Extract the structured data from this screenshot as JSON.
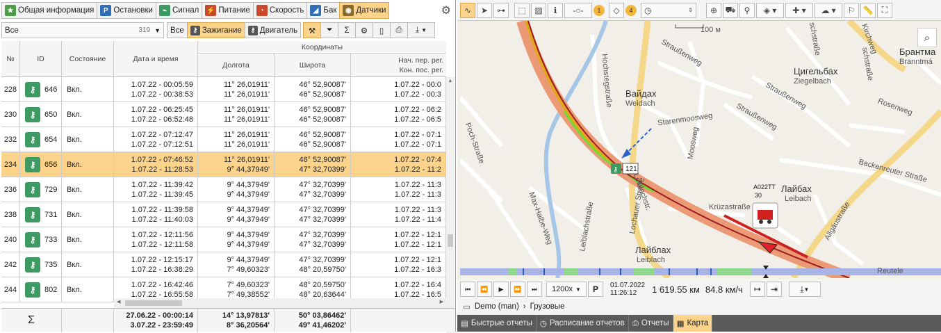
{
  "tabs": [
    {
      "label": "Общая информация",
      "icon": "star-icon",
      "color": "#4a9e4a"
    },
    {
      "label": "Остановки",
      "icon": "parking-icon",
      "color": "#2f6eb5"
    },
    {
      "label": "Сигнал",
      "icon": "signal-icon",
      "color": "#3e9a63"
    },
    {
      "label": "Питание",
      "icon": "power-icon",
      "color": "#c9492b"
    },
    {
      "label": "Скорость",
      "icon": "speed-icon",
      "color": "#c9492b"
    },
    {
      "label": "Бак",
      "icon": "fuel-icon",
      "color": "#2f6eb5"
    },
    {
      "label": "Датчики",
      "icon": "sensor-icon",
      "color": "#8a6a2a"
    }
  ],
  "toolbar": {
    "filter_value": "Все",
    "filter_count": "319",
    "all_button": "Все",
    "ignition_button": "Зажигание",
    "engine_button": "Двигатель"
  },
  "table": {
    "headers": {
      "num": "№",
      "id": "ID",
      "state": "Состояние",
      "datetime": "Дата и время",
      "coords": "Координаты",
      "lon": "Долгота",
      "lat": "Широта",
      "region_1": "Нач. пер. рег.",
      "region_2": "Кон. пос. рег."
    },
    "rows": [
      {
        "n": "228",
        "id": "646",
        "state": "Вкл.",
        "d1": "1.07.22 - 00:05:59",
        "d2": "1.07.22 - 00:38:53",
        "lon1": "11° 26,01911'",
        "lon2": "11° 26,01911'",
        "lat1": "46° 52,90087'",
        "lat2": "46° 52,90087'",
        "r1": "1.07.22 - 00:0",
        "r2": "1.07.22 - 00:3"
      },
      {
        "n": "230",
        "id": "650",
        "state": "Вкл.",
        "d1": "1.07.22 - 06:25:45",
        "d2": "1.07.22 - 06:52:48",
        "lon1": "11° 26,01911'",
        "lon2": "11° 26,01911'",
        "lat1": "46° 52,90087'",
        "lat2": "46° 52,90087'",
        "r1": "1.07.22 - 06:2",
        "r2": "1.07.22 - 06:5"
      },
      {
        "n": "232",
        "id": "654",
        "state": "Вкл.",
        "d1": "1.07.22 - 07:12:47",
        "d2": "1.07.22 - 07:12:51",
        "lon1": "11° 26,01911'",
        "lon2": "11° 26,01911'",
        "lat1": "46° 52,90087'",
        "lat2": "46° 52,90087'",
        "r1": "1.07.22 - 07:1",
        "r2": "1.07.22 - 07:1"
      },
      {
        "n": "234",
        "id": "656",
        "state": "Вкл.",
        "d1": "1.07.22 - 07:46:52",
        "d2": "1.07.22 - 11:28:53",
        "lon1": "11° 26,01911'",
        "lon2": "9° 44,37949'",
        "lat1": "46° 52,90087'",
        "lat2": "47° 32,70399'",
        "r1": "1.07.22 - 07:4",
        "r2": "1.07.22 - 11:2"
      },
      {
        "n": "236",
        "id": "729",
        "state": "Вкл.",
        "d1": "1.07.22 - 11:39:42",
        "d2": "1.07.22 - 11:39:45",
        "lon1": "9° 44,37949'",
        "lon2": "9° 44,37949'",
        "lat1": "47° 32,70399'",
        "lat2": "47° 32,70399'",
        "r1": "1.07.22 - 11:3",
        "r2": "1.07.22 - 11:3"
      },
      {
        "n": "238",
        "id": "731",
        "state": "Вкл.",
        "d1": "1.07.22 - 11:39:58",
        "d2": "1.07.22 - 11:40:03",
        "lon1": "9° 44,37949'",
        "lon2": "9° 44,37949'",
        "lat1": "47° 32,70399'",
        "lat2": "47° 32,70399'",
        "r1": "1.07.22 - 11:3",
        "r2": "1.07.22 - 11:4"
      },
      {
        "n": "240",
        "id": "733",
        "state": "Вкл.",
        "d1": "1.07.22 - 12:11:56",
        "d2": "1.07.22 - 12:11:58",
        "lon1": "9° 44,37949'",
        "lon2": "9° 44,37949'",
        "lat1": "47° 32,70399'",
        "lat2": "47° 32,70399'",
        "r1": "1.07.22 - 12:1",
        "r2": "1.07.22 - 12:1"
      },
      {
        "n": "242",
        "id": "735",
        "state": "Вкл.",
        "d1": "1.07.22 - 12:15:17",
        "d2": "1.07.22 - 16:38:29",
        "lon1": "9° 44,37949'",
        "lon2": "7° 49,60323'",
        "lat1": "47° 32,70399'",
        "lat2": "48° 20,59750'",
        "r1": "1.07.22 - 12:1",
        "r2": "1.07.22 - 16:3"
      },
      {
        "n": "244",
        "id": "802",
        "state": "Вкл.",
        "d1": "1.07.22 - 16:42:46",
        "d2": "1.07.22 - 16:55:58",
        "lon1": "7° 49,60323'",
        "lon2": "7° 49,38552'",
        "lat1": "48° 20,59750'",
        "lat2": "48° 20,63644'",
        "r1": "1.07.22 - 16:4",
        "r2": "1.07.22 - 16:5"
      }
    ],
    "footer": {
      "sigma": "Σ",
      "d1": "27.06.22 - 00:00:14",
      "d2": "3.07.22 - 23:59:49",
      "lon1": "14° 13,97813'",
      "lon2": "8° 36,20564'",
      "lat1": "50° 03,86462'",
      "lat2": "49° 41,46202'"
    }
  },
  "map": {
    "badge_1": "1",
    "badge_2": "4",
    "scale": "100 м",
    "labels": {
      "weidach_ru": "Вайдах",
      "weidach_de": "Weidach",
      "ziegelbach_ru": "Цигельбах",
      "ziegelbach_de": "Ziegelbach",
      "brant_ru": "Брантма",
      "brant_de": "Branntmá",
      "laibach_ru": "Лайбах",
      "laibach_de": "Leibach",
      "laiblach_ru": "Лайблах",
      "laiblach_de": "Leiblach",
      "strauss1": "Straußenweg",
      "strauss2": "Straußenweg",
      "strauss3": "Straußenweg",
      "starenmoos": "Starenmoosweg",
      "moosweg": "Moosweg",
      "rosenweg": "Rosenweg",
      "backenreuter": "Backenreuter Straße",
      "krueza": "Krüzastraße",
      "allgau": "Allgäustraße",
      "lochauer": "Lochauer Straße",
      "leiblach_str": "Leiblachstraße",
      "maxhalbe": "Max-Halbe-Weg",
      "hochsteg": "Hochstegstraße",
      "kirchweg": "Kirchweg",
      "schstr": "schstraße",
      "sch2": "schstraße",
      "reutele": "Reutele",
      "poch": "Poch-Straße",
      "leiblachstr2": "Leiblachstr."
    },
    "vehicle_plate": "А022ТТ",
    "vehicle_num": "30",
    "marker_num": "121"
  },
  "player": {
    "speed_multiplier": "1200x",
    "parking_button": "P",
    "date": "01.07.2022",
    "time": "11:26:12",
    "distance": "1 619.55 км",
    "velocity": "84.8 км/ч"
  },
  "breadcrumb": {
    "root": "Demo (man)",
    "child": "Грузовые"
  },
  "bottom_tabs": [
    {
      "label": "Быстрые отчеты",
      "icon": "quick-reports-icon"
    },
    {
      "label": "Расписание отчетов",
      "icon": "clock-icon"
    },
    {
      "label": "Отчеты",
      "icon": "print-icon"
    },
    {
      "label": "Карта",
      "icon": "map-icon"
    }
  ]
}
